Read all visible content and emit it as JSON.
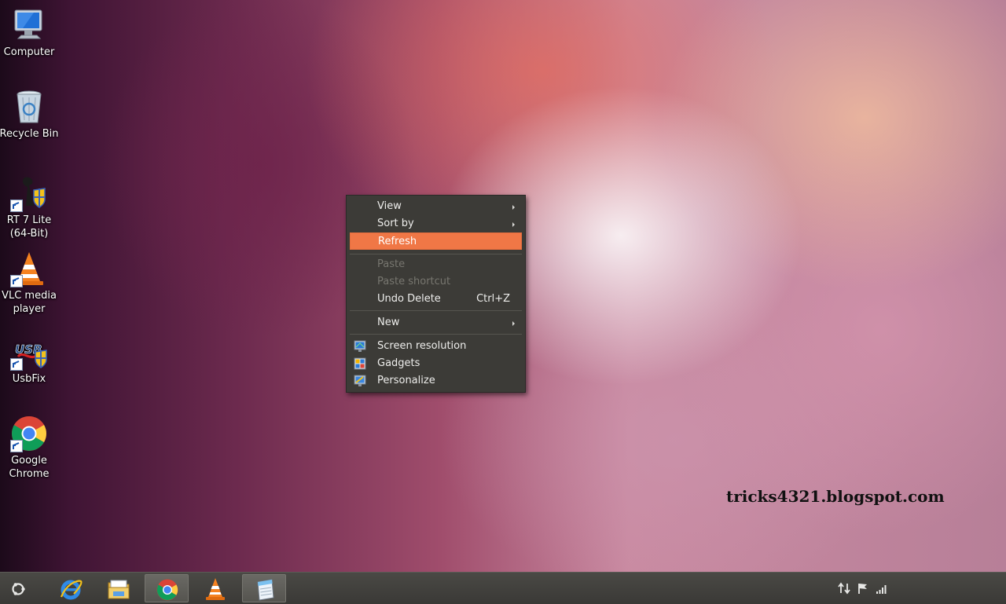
{
  "desktop": {
    "icons": [
      {
        "label": "Computer"
      },
      {
        "label": "Recycle Bin"
      },
      {
        "label_line1": "RT 7 Lite",
        "label_line2": "(64-Bit)"
      },
      {
        "label_line1": "VLC media",
        "label_line2": "player"
      },
      {
        "label": "UsbFix",
        "logo_text": "USB"
      },
      {
        "label_line1": "Google",
        "label_line2": "Chrome"
      }
    ],
    "watermark": "tricks4321.blogspot.com"
  },
  "context_menu": {
    "items": [
      {
        "label": "View",
        "submenu": true
      },
      {
        "label": "Sort by",
        "submenu": true
      },
      {
        "label": "Refresh",
        "highlighted": true
      },
      {
        "label": "Paste",
        "disabled": true
      },
      {
        "label": "Paste shortcut",
        "disabled": true
      },
      {
        "label": "Undo Delete",
        "shortcut": "Ctrl+Z"
      },
      {
        "label": "New",
        "submenu": true
      },
      {
        "label": "Screen resolution",
        "icon": "screen-resolution-icon"
      },
      {
        "label": "Gadgets",
        "icon": "gadgets-icon"
      },
      {
        "label": "Personalize",
        "icon": "personalize-icon"
      }
    ]
  },
  "taskbar": {
    "start_icon": "ubuntu-logo-icon",
    "pinned": [
      {
        "name": "internet-explorer-icon"
      },
      {
        "name": "file-explorer-icon"
      },
      {
        "name": "google-chrome-icon",
        "active": true
      },
      {
        "name": "vlc-icon"
      },
      {
        "name": "notepad-icon",
        "active": true
      }
    ],
    "tray": [
      "network-transfer-icon",
      "action-center-flag-icon",
      "signal-strength-icon"
    ]
  },
  "colors": {
    "menu_bg": "#3c3b37",
    "menu_highlight": "#f07746",
    "taskbar_bg": "#3f3e3a"
  }
}
